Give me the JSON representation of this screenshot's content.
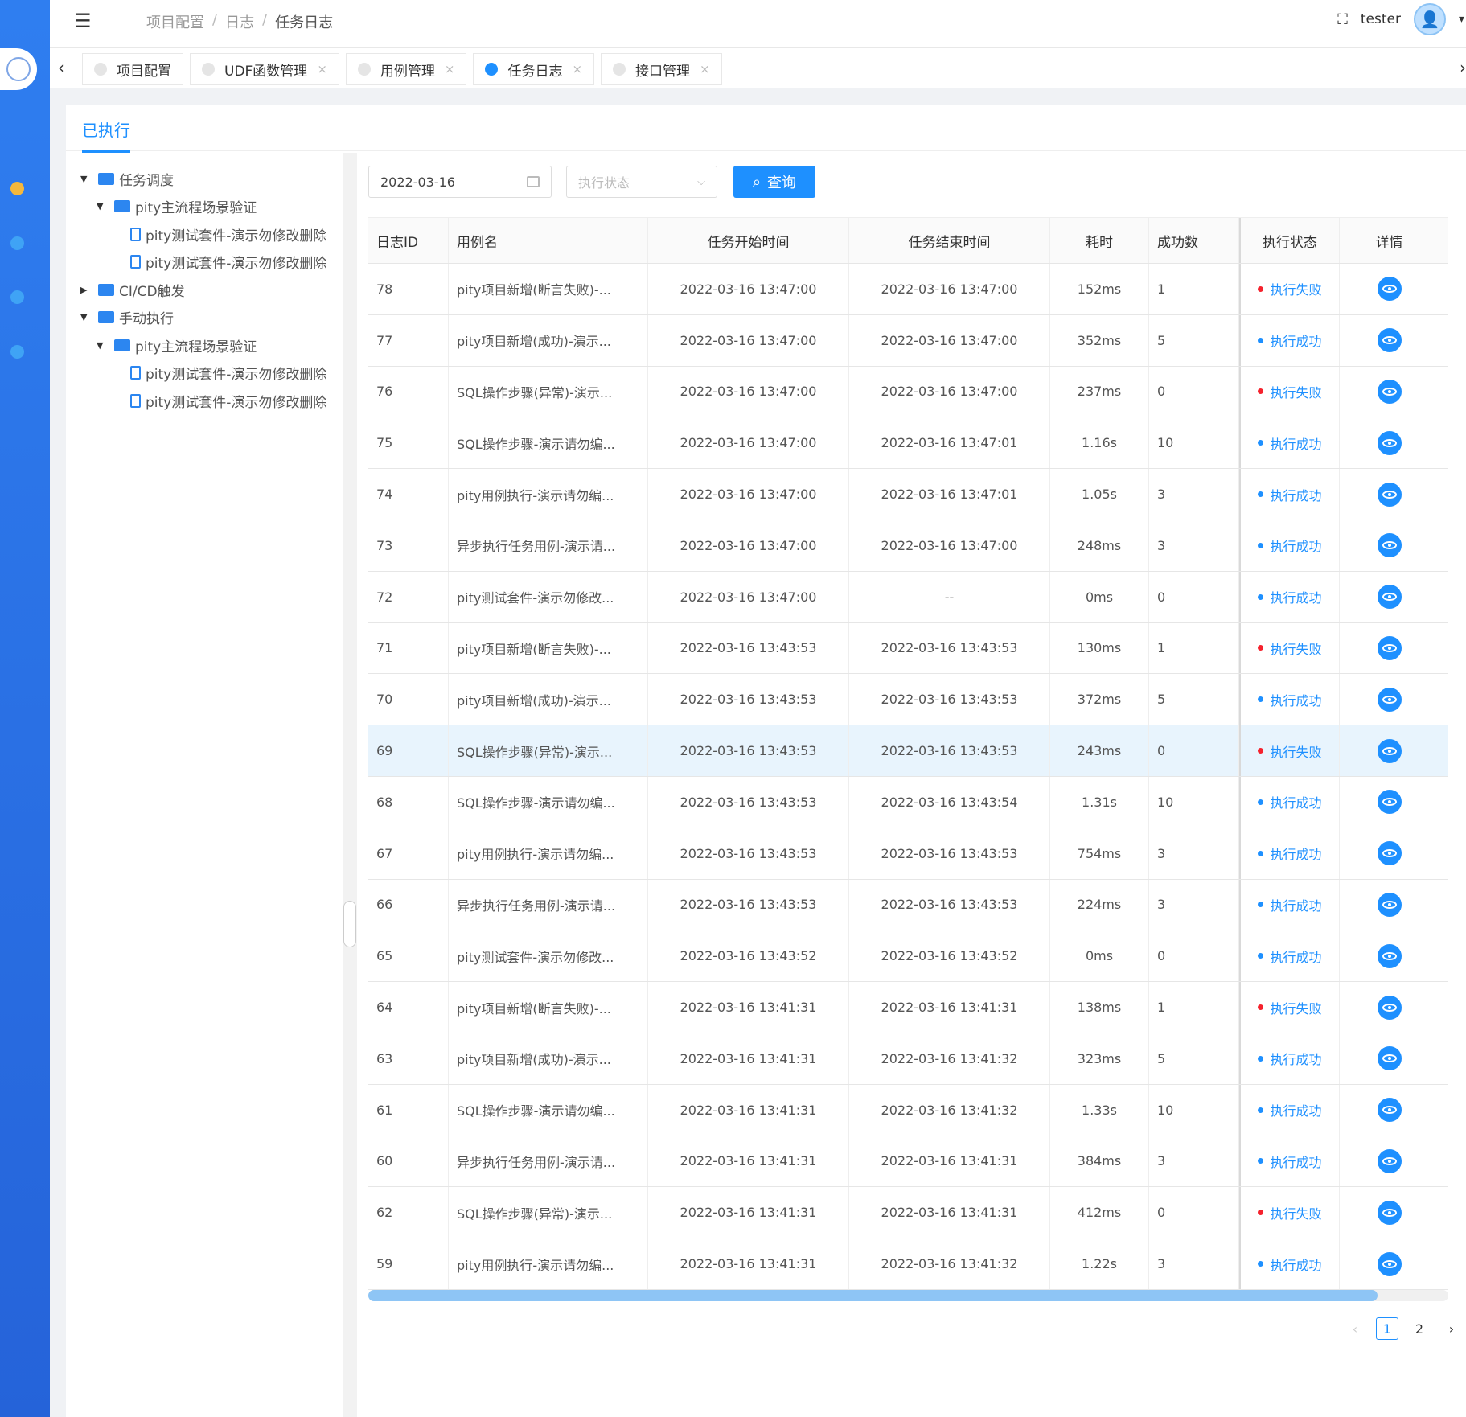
{
  "header": {
    "breadcrumb": [
      "项目配置",
      "日志",
      "任务日志"
    ],
    "username": "tester"
  },
  "tabs": [
    {
      "label": "项目配置",
      "active": false
    },
    {
      "label": "UDF函数管理",
      "active": false
    },
    {
      "label": "用例管理",
      "active": false
    },
    {
      "label": "任务日志",
      "active": true
    },
    {
      "label": "接口管理",
      "active": false
    }
  ],
  "card": {
    "tab_label": "已执行"
  },
  "tree": [
    {
      "label": "任务调度",
      "level": 0,
      "type": "folder",
      "expanded": true
    },
    {
      "label": "pity主流程场景验证",
      "level": 1,
      "type": "folder",
      "expanded": true
    },
    {
      "label": "pity测试套件-演示勿修改删除",
      "level": 2,
      "type": "file"
    },
    {
      "label": "pity测试套件-演示勿修改删除",
      "level": 2,
      "type": "file"
    },
    {
      "label": "CI/CD触发",
      "level": 0,
      "type": "folder",
      "expanded": false
    },
    {
      "label": "手动执行",
      "level": 0,
      "type": "folder",
      "expanded": true
    },
    {
      "label": "pity主流程场景验证",
      "level": 1,
      "type": "folder",
      "expanded": true
    },
    {
      "label": "pity测试套件-演示勿修改删除",
      "level": 2,
      "type": "file"
    },
    {
      "label": "pity测试套件-演示勿修改删除",
      "level": 2,
      "type": "file"
    }
  ],
  "filters": {
    "date": "2022-03-16",
    "status_placeholder": "执行状态",
    "query_label": "查询"
  },
  "table": {
    "columns": [
      "日志ID",
      "用例名",
      "任务开始时间",
      "任务结束时间",
      "耗时",
      "成功数",
      "执行状态",
      "详情"
    ],
    "rows": [
      {
        "id": "78",
        "name": "pity项目新增(断言失败)-...",
        "start": "2022-03-16 13:47:00",
        "end": "2022-03-16 13:47:00",
        "cost": "152ms",
        "success": "1",
        "status": "执行失败",
        "ok": false
      },
      {
        "id": "77",
        "name": "pity项目新增(成功)-演示...",
        "start": "2022-03-16 13:47:00",
        "end": "2022-03-16 13:47:00",
        "cost": "352ms",
        "success": "5",
        "status": "执行成功",
        "ok": true
      },
      {
        "id": "76",
        "name": "SQL操作步骤(异常)-演示...",
        "start": "2022-03-16 13:47:00",
        "end": "2022-03-16 13:47:00",
        "cost": "237ms",
        "success": "0",
        "status": "执行失败",
        "ok": false
      },
      {
        "id": "75",
        "name": "SQL操作步骤-演示请勿编...",
        "start": "2022-03-16 13:47:00",
        "end": "2022-03-16 13:47:01",
        "cost": "1.16s",
        "success": "10",
        "status": "执行成功",
        "ok": true
      },
      {
        "id": "74",
        "name": "pity用例执行-演示请勿编...",
        "start": "2022-03-16 13:47:00",
        "end": "2022-03-16 13:47:01",
        "cost": "1.05s",
        "success": "3",
        "status": "执行成功",
        "ok": true
      },
      {
        "id": "73",
        "name": "异步执行任务用例-演示请...",
        "start": "2022-03-16 13:47:00",
        "end": "2022-03-16 13:47:00",
        "cost": "248ms",
        "success": "3",
        "status": "执行成功",
        "ok": true
      },
      {
        "id": "72",
        "name": "pity测试套件-演示勿修改...",
        "start": "2022-03-16 13:47:00",
        "end": "--",
        "cost": "0ms",
        "success": "0",
        "status": "执行成功",
        "ok": true
      },
      {
        "id": "71",
        "name": "pity项目新增(断言失败)-...",
        "start": "2022-03-16 13:43:53",
        "end": "2022-03-16 13:43:53",
        "cost": "130ms",
        "success": "1",
        "status": "执行失败",
        "ok": false
      },
      {
        "id": "70",
        "name": "pity项目新增(成功)-演示...",
        "start": "2022-03-16 13:43:53",
        "end": "2022-03-16 13:43:53",
        "cost": "372ms",
        "success": "5",
        "status": "执行成功",
        "ok": true
      },
      {
        "id": "69",
        "name": "SQL操作步骤(异常)-演示...",
        "start": "2022-03-16 13:43:53",
        "end": "2022-03-16 13:43:53",
        "cost": "243ms",
        "success": "0",
        "status": "执行失败",
        "ok": false,
        "highlight": true
      },
      {
        "id": "68",
        "name": "SQL操作步骤-演示请勿编...",
        "start": "2022-03-16 13:43:53",
        "end": "2022-03-16 13:43:54",
        "cost": "1.31s",
        "success": "10",
        "status": "执行成功",
        "ok": true
      },
      {
        "id": "67",
        "name": "pity用例执行-演示请勿编...",
        "start": "2022-03-16 13:43:53",
        "end": "2022-03-16 13:43:53",
        "cost": "754ms",
        "success": "3",
        "status": "执行成功",
        "ok": true
      },
      {
        "id": "66",
        "name": "异步执行任务用例-演示请...",
        "start": "2022-03-16 13:43:53",
        "end": "2022-03-16 13:43:53",
        "cost": "224ms",
        "success": "3",
        "status": "执行成功",
        "ok": true
      },
      {
        "id": "65",
        "name": "pity测试套件-演示勿修改...",
        "start": "2022-03-16 13:43:52",
        "end": "2022-03-16 13:43:52",
        "cost": "0ms",
        "success": "0",
        "status": "执行成功",
        "ok": true
      },
      {
        "id": "64",
        "name": "pity项目新增(断言失败)-...",
        "start": "2022-03-16 13:41:31",
        "end": "2022-03-16 13:41:31",
        "cost": "138ms",
        "success": "1",
        "status": "执行失败",
        "ok": false
      },
      {
        "id": "63",
        "name": "pity项目新增(成功)-演示...",
        "start": "2022-03-16 13:41:31",
        "end": "2022-03-16 13:41:32",
        "cost": "323ms",
        "success": "5",
        "status": "执行成功",
        "ok": true
      },
      {
        "id": "61",
        "name": "SQL操作步骤-演示请勿编...",
        "start": "2022-03-16 13:41:31",
        "end": "2022-03-16 13:41:32",
        "cost": "1.33s",
        "success": "10",
        "status": "执行成功",
        "ok": true
      },
      {
        "id": "60",
        "name": "异步执行任务用例-演示请...",
        "start": "2022-03-16 13:41:31",
        "end": "2022-03-16 13:41:31",
        "cost": "384ms",
        "success": "3",
        "status": "执行成功",
        "ok": true
      },
      {
        "id": "62",
        "name": "SQL操作步骤(异常)-演示...",
        "start": "2022-03-16 13:41:31",
        "end": "2022-03-16 13:41:31",
        "cost": "412ms",
        "success": "0",
        "status": "执行失败",
        "ok": false
      },
      {
        "id": "59",
        "name": "pity用例执行-演示请勿编...",
        "start": "2022-03-16 13:41:31",
        "end": "2022-03-16 13:41:32",
        "cost": "1.22s",
        "success": "3",
        "status": "执行成功",
        "ok": true
      }
    ]
  },
  "pagination": {
    "pages": [
      "1",
      "2"
    ],
    "current": "1"
  },
  "colors": {
    "primary": "#1e90ff",
    "fail_dot": "#f5222d",
    "success_dot": "#1e90ff",
    "sidebar_dots": [
      "#f5b83d",
      "#3fa3f5",
      "#3fa3f5",
      "#3fa3f5"
    ]
  },
  "icons": {
    "menu": "menu-fold-icon",
    "fullscreen": "fullscreen-icon",
    "calendar": "calendar-icon",
    "search": "search-icon",
    "detail": "eye-icon"
  }
}
